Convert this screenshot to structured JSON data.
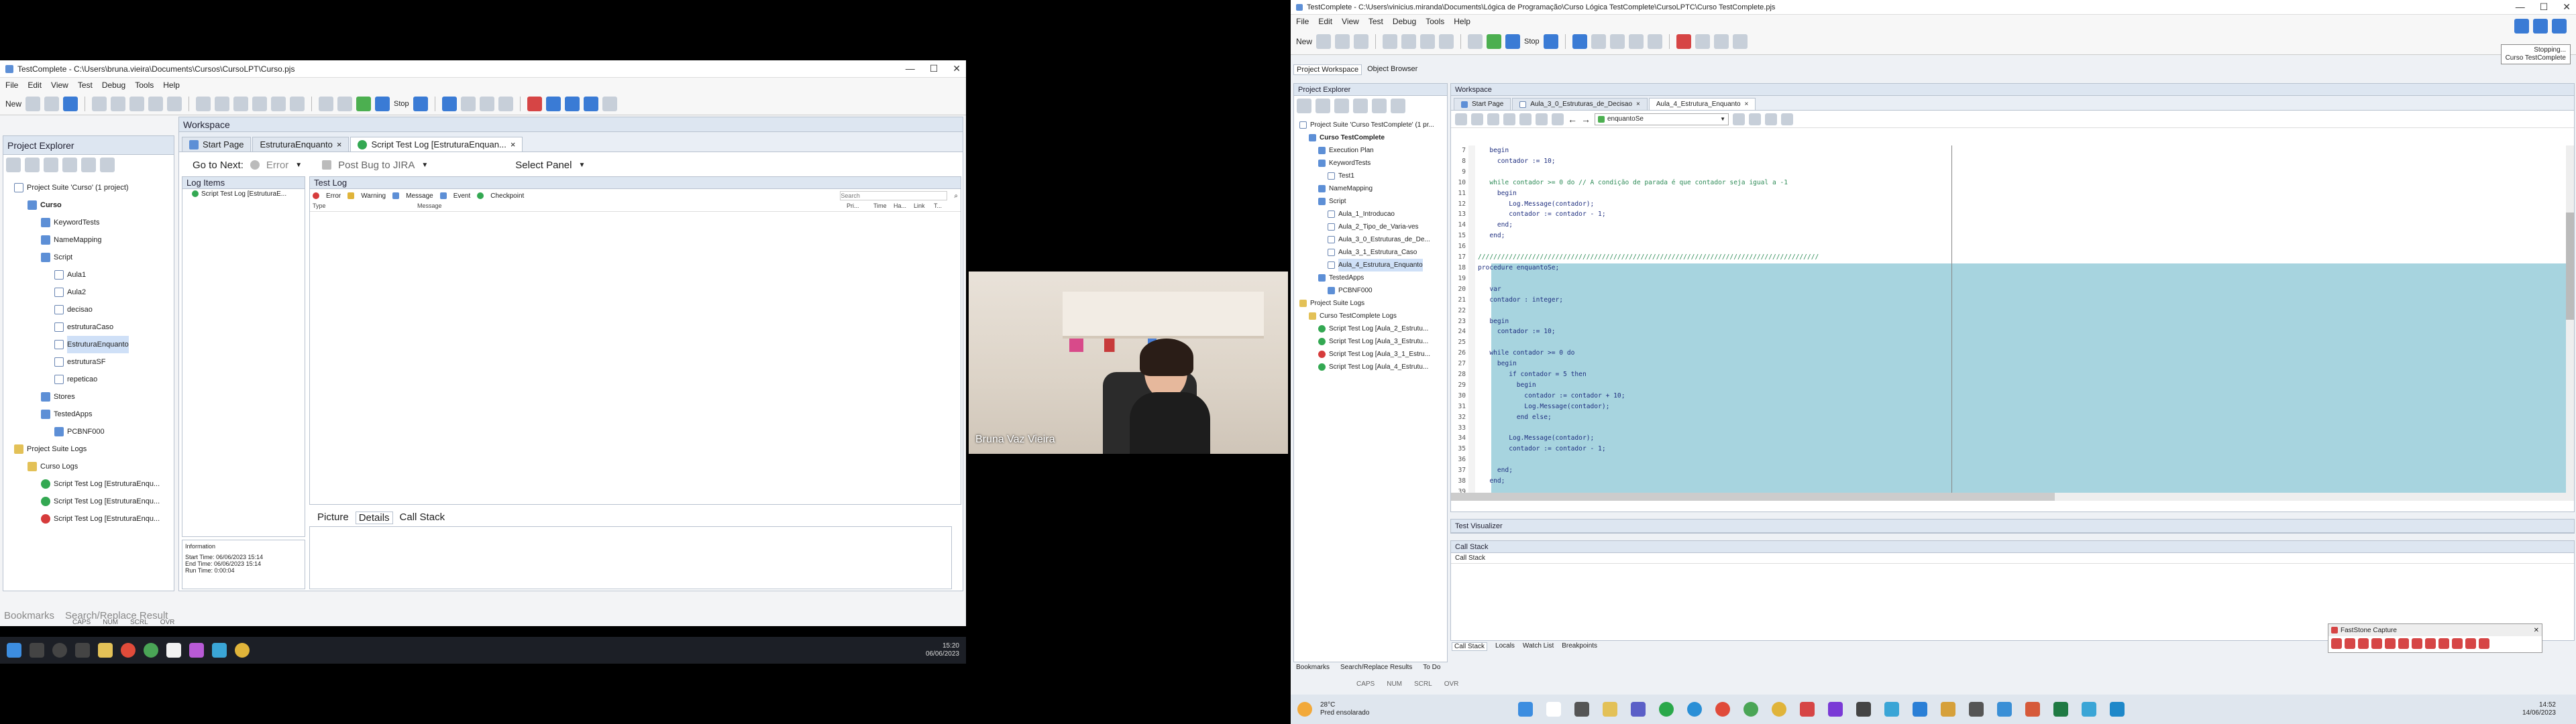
{
  "left": {
    "title": "TestComplete - C:\\Users\\bruna.vieira\\Documents\\Cursos\\CursoLPT\\Curso.pjs",
    "menu": [
      "File",
      "Edit",
      "View",
      "Test",
      "Debug",
      "Tools",
      "Help"
    ],
    "new_label": "New",
    "stop_label": "Stop",
    "project_explorer": "Project Explorer",
    "workspace": "Workspace",
    "tree": [
      "Project Suite 'Curso' (1 project)",
      "Curso",
      "KeywordTests",
      "NameMapping",
      "Script",
      "Aula1",
      "Aula2",
      "decisao",
      "estruturaCaso",
      "EstruturaEnquanto",
      "estruturaSF",
      "repeticao",
      "Stores",
      "TestedApps",
      "PCBNF000",
      "Project Suite Logs",
      "Curso Logs",
      "Script Test Log [EstruturaEnqu...",
      "Script Test Log [EstruturaEnqu...",
      "Script Test Log [EstruturaEnqu..."
    ],
    "tabs": [
      "Start Page",
      "EstruturaEnquanto",
      "Script Test Log [EstruturaEnquan..."
    ],
    "goto_next": "Go to Next:",
    "error_dd": "Error",
    "post_bug": "Post Bug to JIRA",
    "select_panel": "Select Panel",
    "log_items": "Log Items",
    "log_item_0": "Script Test Log [EstruturaE...",
    "test_log": "Test Log",
    "filters": [
      "Error",
      "Warning",
      "Message",
      "Event",
      "Checkpoint"
    ],
    "search_placeholder": "Search",
    "cols": [
      "Type",
      "Message",
      "Pri...",
      "Time",
      "Ha...",
      "Link",
      "T..."
    ],
    "bottom_tabs": [
      "Picture",
      "Details",
      "Call Stack"
    ],
    "info_title": "Information",
    "info_lines": [
      "Start Time: 06/06/2023 15:14",
      "End Time: 06/06/2023 15:14",
      "Run Time: 0:00:04"
    ],
    "bottom_panels": [
      "Bookmarks",
      "Search/Replace Result"
    ],
    "status": [
      "CAPS",
      "NUM",
      "SCRL",
      "OVR"
    ],
    "clock_time": "15:20",
    "clock_date": "06/06/2023"
  },
  "video": {
    "name": "Bruna Vaz Vieira"
  },
  "right": {
    "title": "TestComplete - C:\\Users\\vinicius.miranda\\Documents\\Lógica de Programação\\Curso Lógica TestComplete\\CursoLPTC\\Curso TestComplete.pjs",
    "menu": [
      "File",
      "Edit",
      "View",
      "Test",
      "Debug",
      "Tools",
      "Help"
    ],
    "new_label": "New",
    "stop_label": "Stop",
    "tooltip": [
      "Stopping...",
      "Curso TestComplete"
    ],
    "ws_tabs": [
      "Project Workspace",
      "Object Browser"
    ],
    "project_explorer": "Project Explorer",
    "workspace": "Workspace",
    "tree": [
      "Project Suite 'Curso TestComplete' (1 pr...",
      "Curso TestComplete",
      "Execution Plan",
      "KeywordTests",
      "Test1",
      "NameMapping",
      "Script",
      "Aula_1_Introducao",
      "Aula_2_Tipo_de_Varia-ves",
      "Aula_3_0_Estruturas_de_De...",
      "Aula_3_1_Estrutura_Caso",
      "Aula_4_Estrutura_Enquanto",
      "TestedApps",
      "PCBNF000",
      "Project Suite Logs",
      "Curso TestComplete Logs",
      "Script Test Log [Aula_2_Estrutu...",
      "Script Test Log [Aula_3_Estrutu...",
      "Script Test Log [Aula_3_1_Estru...",
      "Script Test Log [Aula_4_Estrutu..."
    ],
    "tabs": [
      "Start Page",
      "Aula_3_0_Estruturas_de_Decisao",
      "Aula_4_Estrutura_Enquanto"
    ],
    "routine": "enquantoSe",
    "line_numbers": [
      "7",
      "8",
      "9",
      "10",
      "11",
      "12",
      "13",
      "14",
      "15",
      "16",
      "17",
      "18",
      "19",
      "20",
      "21",
      "22",
      "23",
      "24",
      "25",
      "26",
      "27",
      "28",
      "29",
      "30",
      "31",
      "32",
      "33",
      "34",
      "35",
      "36",
      "37",
      "38",
      "39"
    ],
    "code_lines": [
      "   begin",
      "     contador := 10;",
      "",
      "   while contador >= 0 do // A condição de parada é que contador seja igual a -1",
      "     begin",
      "        Log.Message(contador);",
      "        contador := contador - 1;",
      "     end;",
      "   end;",
      "",
      "////////////////////////////////////////////////////////////////////////////////////////",
      "procedure enquantoSe;",
      "",
      "   var",
      "   contador : integer;",
      "",
      "   begin",
      "     contador := 10;",
      "",
      "   while contador >= 0 do",
      "     begin",
      "        if contador = 5 then",
      "          begin",
      "            contador := contador + 10;",
      "            Log.Message(contador);",
      "          end else;",
      "",
      "        Log.Message(contador);",
      "        contador := contador - 1;",
      "",
      "     end;",
      "   end;",
      ""
    ],
    "test_visualizer": "Test Visualizer",
    "call_stack": "Call Stack",
    "call_stack_col": "Call Stack",
    "bottom_tabs": [
      "Call Stack",
      "Locals",
      "Watch List",
      "Breakpoints"
    ],
    "bottom_panels": [
      "Bookmarks",
      "Search/Replace Results",
      "To Do"
    ],
    "status": [
      "CAPS",
      "NUM",
      "SCRL",
      "OVR"
    ],
    "faststone": "FastStone Capture",
    "weather_temp": "28°C",
    "weather_desc": "Pred ensolarado",
    "clock_time": "14:52",
    "clock_date": "14/06/2023"
  }
}
